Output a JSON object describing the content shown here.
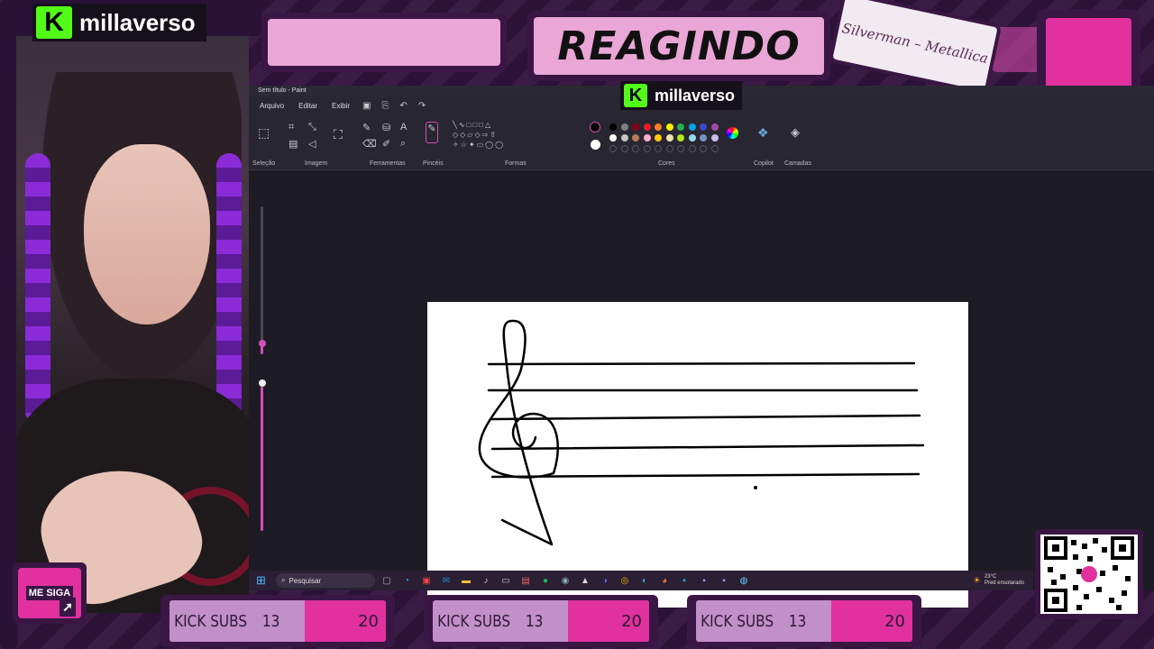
{
  "overlay": {
    "brand_name": "millaverso",
    "brand_logo_letter": "K",
    "title": "REAGINDO",
    "song_tag": "Silverman – Metallica",
    "follow_label": "ME SIGA"
  },
  "paint": {
    "window_title": "Sem título - Paint",
    "menu": [
      "Arquivo",
      "Editar",
      "Exibir"
    ],
    "groups": {
      "selecao": "Seleção",
      "imagem": "Imagem",
      "ferramentas": "Ferramentas",
      "pinceis": "Pincéis",
      "formas": "Formas",
      "cores": "Cores",
      "copilot": "Copilot",
      "camadas": "Camadas"
    },
    "color_swatches_row1": [
      "#000000",
      "#7f7f7f",
      "#880015",
      "#ed1c24",
      "#ff7f27",
      "#fff200",
      "#22b14c",
      "#00a2e8",
      "#3f48cc",
      "#a349a4"
    ],
    "color_swatches_row2": [
      "#ffffff",
      "#c3c3c3",
      "#b97a57",
      "#ffaec9",
      "#ffc90e",
      "#efe4b0",
      "#b5e61d",
      "#99d9ea",
      "#7092be",
      "#c8bfe7"
    ],
    "primary_color": "#000000",
    "secondary_color": "#ffffff"
  },
  "taskbar": {
    "search_placeholder": "Pesquisar",
    "weather_temp": "23°C",
    "weather_text": "Pred ensolarado",
    "apps": [
      "file-explorer-icon",
      "edge-icon",
      "store-icon",
      "outlook-icon",
      "folder-icon",
      "music-icon",
      "terminal-icon",
      "photos-icon",
      "spotify-icon",
      "steam-icon",
      "epic-icon",
      "discord-icon",
      "chrome-icon",
      "browser-icon",
      "firefox-icon",
      "photoshop-icon",
      "after-effects-icon",
      "premiere-icon",
      "globe-icon"
    ]
  },
  "subs": [
    {
      "label": "KICK SUBS",
      "current": "13",
      "goal": "20"
    },
    {
      "label": "KICK SUBS",
      "current": "13",
      "goal": "20"
    },
    {
      "label": "KICK SUBS",
      "current": "13",
      "goal": "20"
    }
  ]
}
